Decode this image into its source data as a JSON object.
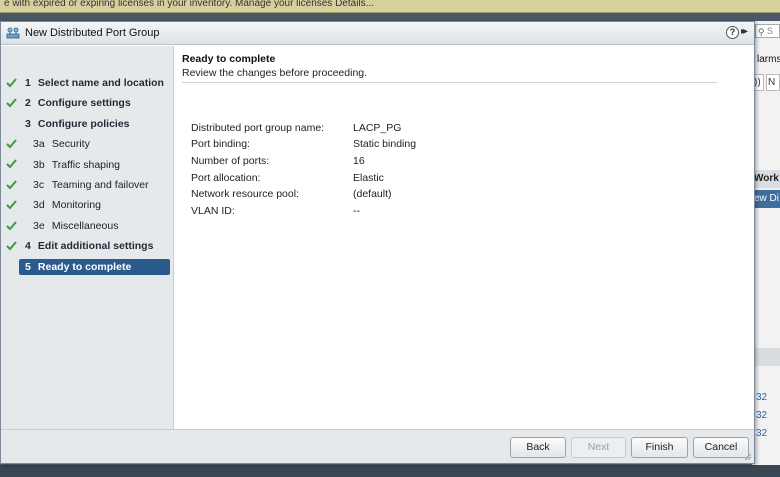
{
  "background": {
    "banner_text": "e with expired or expiring licenses in your inventory.  Manage your licenses   Details...",
    "search_placeholder": "S",
    "alarms_label": "larms",
    "tab_a": "))",
    "tab_b": "N",
    "work_label": "Work I",
    "new_d_label": "ew Di",
    "links": [
      "32",
      "32",
      "32"
    ]
  },
  "dialog": {
    "title": "New Distributed Port Group",
    "help_icon": "?",
    "expand_icon": "▸▸",
    "steps": [
      {
        "num": "1",
        "label": "Select name and location",
        "main": true,
        "done": true
      },
      {
        "num": "2",
        "label": "Configure settings",
        "main": true,
        "done": true
      },
      {
        "num": "3",
        "label": "Configure policies",
        "main": true,
        "done": false
      },
      {
        "num": "3a",
        "label": "Security",
        "main": false,
        "done": true
      },
      {
        "num": "3b",
        "label": "Traffic shaping",
        "main": false,
        "done": true
      },
      {
        "num": "3c",
        "label": "Teaming and failover",
        "main": false,
        "done": true
      },
      {
        "num": "3d",
        "label": "Monitoring",
        "main": false,
        "done": true
      },
      {
        "num": "3e",
        "label": "Miscellaneous",
        "main": false,
        "done": true
      },
      {
        "num": "4",
        "label": "Edit additional settings",
        "main": true,
        "done": true
      },
      {
        "num": "5",
        "label": "Ready to complete",
        "main": true,
        "done": false,
        "active": true
      }
    ],
    "content": {
      "title": "Ready to complete",
      "subtitle": "Review the changes before proceeding.",
      "summary": [
        {
          "key": "Distributed port group name:",
          "value": "LACP_PG"
        },
        {
          "key": "Port binding:",
          "value": "Static binding"
        },
        {
          "key": "Number of ports:",
          "value": "16"
        },
        {
          "key": "Port allocation:",
          "value": "Elastic"
        },
        {
          "key": "Network resource pool:",
          "value": "(default)"
        },
        {
          "key": "VLAN ID:",
          "value": "--"
        }
      ]
    },
    "buttons": {
      "back": "Back",
      "next": "Next",
      "finish": "Finish",
      "cancel": "Cancel"
    }
  },
  "colors": {
    "accent": "#2b5b8c",
    "check": "#3c9a3c"
  }
}
